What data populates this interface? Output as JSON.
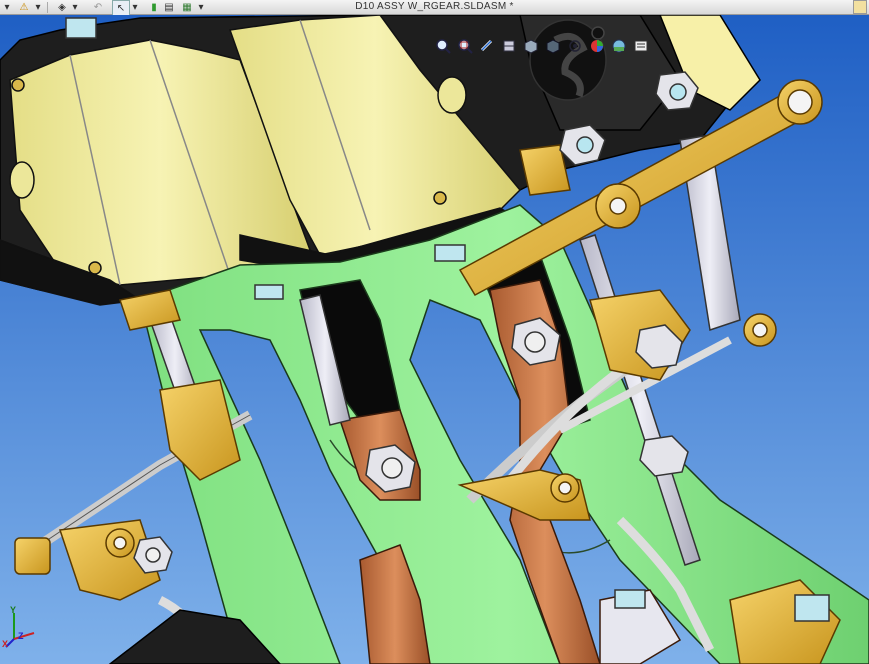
{
  "window": {
    "document_title": "D10 ASSY W_RGEAR.SLDASM *"
  },
  "toolbar": {
    "items": [
      {
        "name": "open-dropdown-arrow",
        "glyph": "▾"
      },
      {
        "name": "warning-icon",
        "glyph": "⚠"
      },
      {
        "name": "rebuild-dropdown-arrow",
        "glyph": "▾"
      },
      {
        "name": "3d-box-icon",
        "glyph": "◈"
      },
      {
        "name": "options-dropdown-arrow",
        "glyph": "▾"
      },
      {
        "name": "undo-icon",
        "glyph": "↶"
      },
      {
        "name": "select-arrow-icon",
        "glyph": "↖"
      },
      {
        "name": "select-dropdown-arrow",
        "glyph": "▾"
      },
      {
        "name": "status-indicator-icon",
        "glyph": "▮"
      },
      {
        "name": "file-properties-icon",
        "glyph": "▤"
      },
      {
        "name": "chart-icon",
        "glyph": "▦"
      },
      {
        "name": "chart-dropdown-arrow",
        "glyph": "▾"
      }
    ]
  },
  "heads_up_toolbar": {
    "icons": [
      "zoom-to-fit-icon",
      "zoom-to-area-icon",
      "previous-view-icon",
      "section-view-icon",
      "view-orientation-icon",
      "display-style-icon",
      "hide-show-items-icon",
      "edit-appearance-icon",
      "apply-scene-icon",
      "view-settings-icon"
    ]
  },
  "triad": {
    "x_label": "X",
    "y_label": "Y",
    "z_label": "Z"
  },
  "colors": {
    "background_top": "#1f5fc4",
    "background_bottom": "#7fb1ea",
    "cylinder_yellow": "#f3efa6",
    "frame_green": "#8fea90",
    "brass": "#e0b43a",
    "copper": "#c9784a",
    "dark_block": "#1e1e1e",
    "steel": "#d6d6e2"
  }
}
